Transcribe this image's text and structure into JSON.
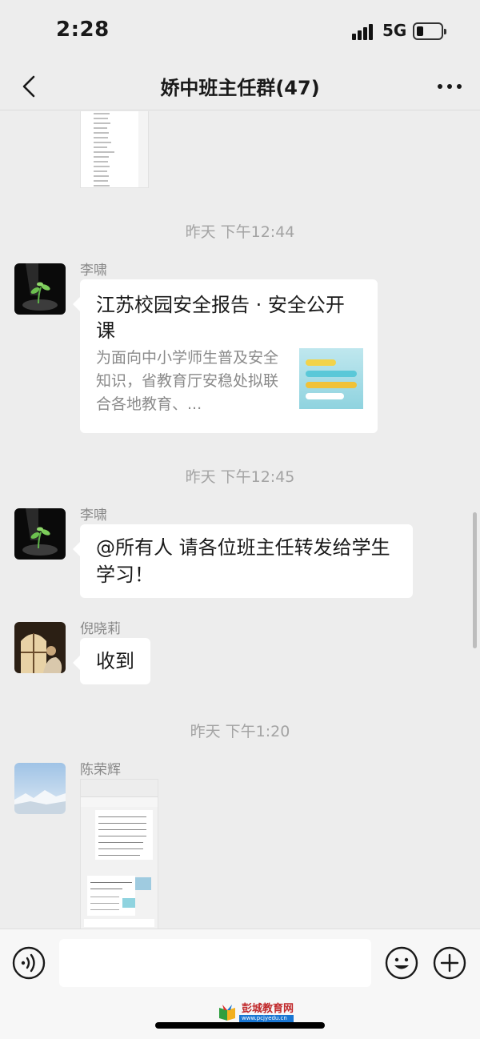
{
  "status_bar": {
    "time": "2:28",
    "network": "5G"
  },
  "nav": {
    "title": "娇中班主任群(47)",
    "back_icon": "chevron-left-icon",
    "more_icon": "more-dots-icon"
  },
  "messages": {
    "sep1": "昨天 下午12:44",
    "sep2": "昨天 下午12:45",
    "sep3": "昨天 下午1:20",
    "link_card": {
      "sender": "李啸",
      "title": "江苏校园安全报告 · 安全公开课",
      "description": "为面向中小学师生普及安全知识，省教育厅安稳处拟联合各地教育、..."
    },
    "text1": {
      "sender": "李啸",
      "text": "@所有人 请各位班主任转发给学生学习！"
    },
    "text2": {
      "sender": "倪晓莉",
      "text": "收到"
    },
    "image_msg": {
      "sender": "陈荣辉"
    }
  },
  "input_bar": {
    "placeholder": "",
    "voice_icon": "voice-icon",
    "emoji_icon": "emoji-icon",
    "add_icon": "add-icon"
  },
  "watermark": {
    "text": "彭城教育网",
    "sub": "www.pcjyedu.cn"
  },
  "colors": {
    "background": "#ededed",
    "bubble": "#ffffff",
    "meta_text": "#a3a3a3",
    "watermark_red": "#c0282a"
  }
}
